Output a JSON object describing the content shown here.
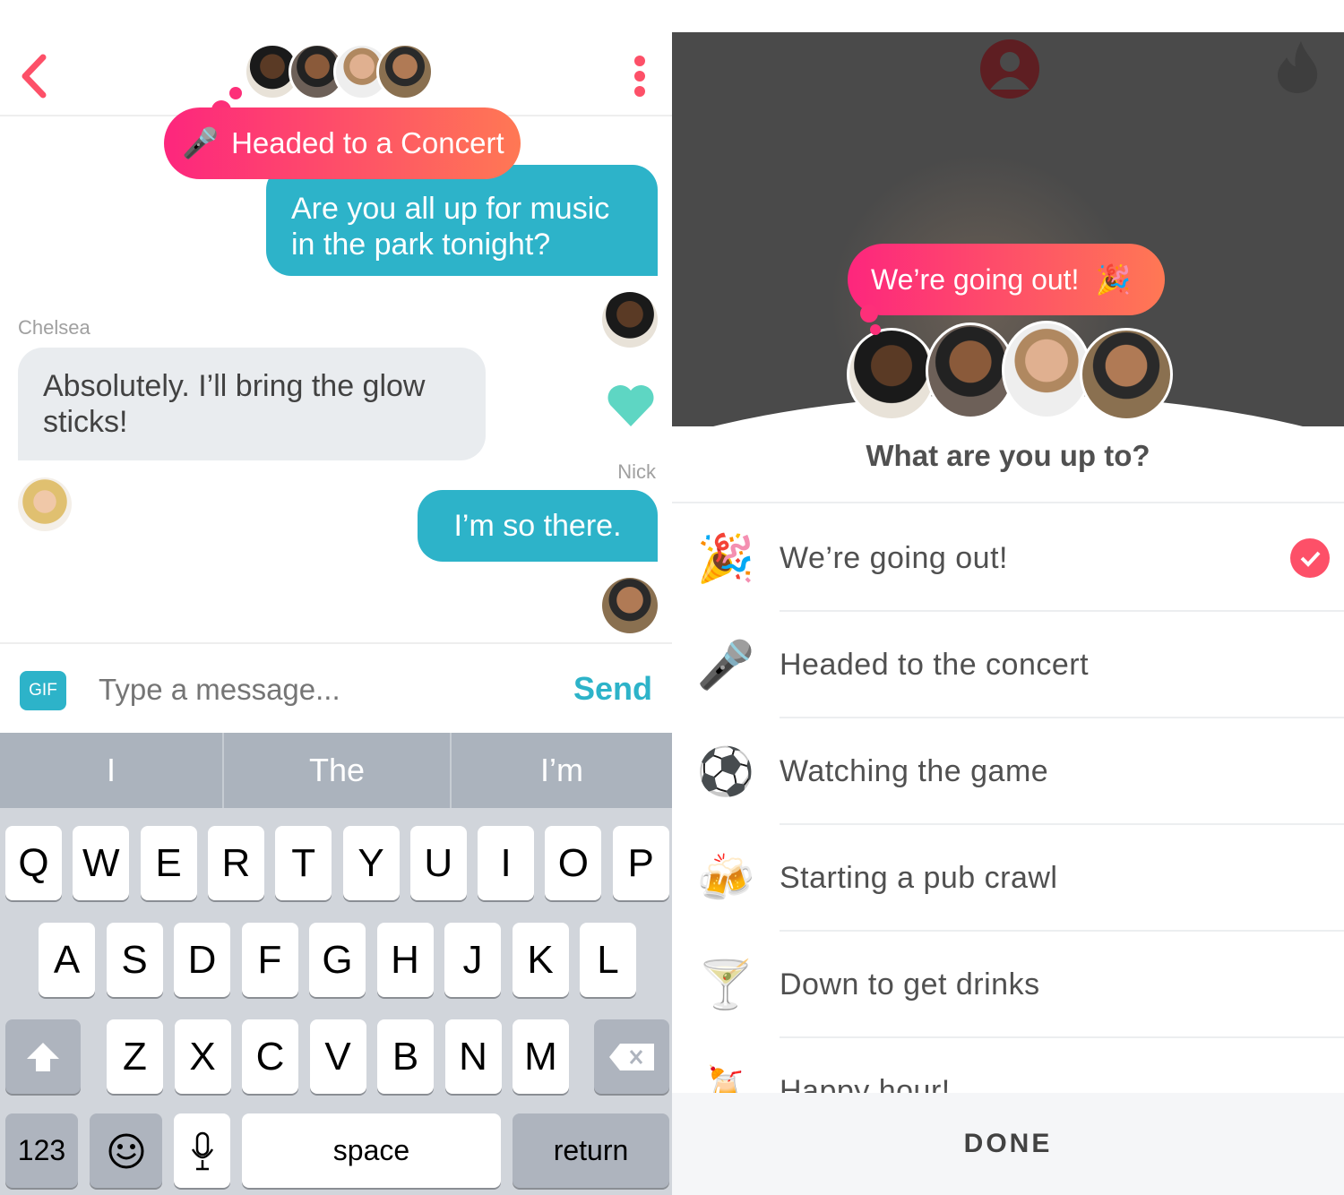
{
  "chat": {
    "back_icon": "chevron-left-icon",
    "more_icon": "vertical-ellipsis-icon",
    "status_pill": {
      "emoji": "🎤",
      "label": "Headed to a Concert"
    },
    "messages": [
      {
        "text": "Are you all up for music in the park tonight?",
        "direction": "outgoing"
      },
      {
        "sender": "Chelsea",
        "text": "Absolutely. I’ll bring the glow sticks!",
        "direction": "incoming",
        "reaction_icon": "heart-icon"
      },
      {
        "sender": "Nick",
        "text": "I’m so there.",
        "direction": "outgoing"
      }
    ],
    "composer": {
      "gif_label": "GIF",
      "placeholder": "Type a message...",
      "send_label": "Send"
    },
    "colors": {
      "accent": "#fd5068",
      "bubble_out": "#2db3c9",
      "bubble_in": "#e9ecef",
      "heart": "#5ed6c3"
    }
  },
  "keyboard": {
    "suggestions": [
      "I",
      "The",
      "I’m"
    ],
    "row1": [
      "Q",
      "W",
      "E",
      "R",
      "T",
      "Y",
      "U",
      "I",
      "O",
      "P"
    ],
    "row2": [
      "A",
      "S",
      "D",
      "F",
      "G",
      "H",
      "J",
      "K",
      "L"
    ],
    "row3": [
      "Z",
      "X",
      "C",
      "V",
      "B",
      "N",
      "M"
    ],
    "numbers_label": "123",
    "space_label": "space",
    "return_label": "return",
    "shift_icon": "shift-icon",
    "delete_icon": "backspace-icon",
    "emoji_icon": "emoji-icon",
    "mic_icon": "microphone-icon"
  },
  "picker": {
    "profile_icon": "profile-icon",
    "flame_icon": "flame-icon",
    "status_pill": {
      "label": "We’re going out!",
      "emoji": "🎉"
    },
    "title": "What are you up to?",
    "options": [
      {
        "emoji": "🎉",
        "label": "We’re going out!",
        "selected": true
      },
      {
        "emoji": "🎤",
        "label": "Headed to the concert",
        "selected": false
      },
      {
        "emoji": "⚽",
        "label": "Watching the game",
        "selected": false
      },
      {
        "emoji": "🍻",
        "label": "Starting a pub crawl",
        "selected": false
      },
      {
        "emoji": "🍸",
        "label": "Down to get drinks",
        "selected": false
      },
      {
        "emoji": "🍹",
        "label": "Happy hour!",
        "selected": false
      }
    ],
    "done_label": "DONE"
  }
}
